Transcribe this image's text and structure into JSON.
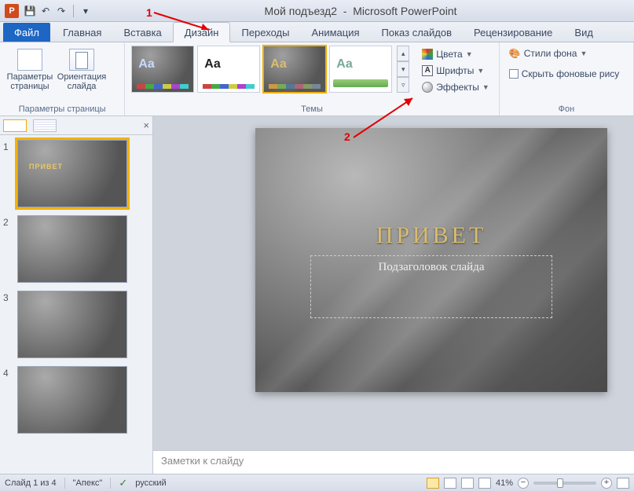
{
  "titlebar": {
    "doc": "Мой подъезд2",
    "app": "Microsoft PowerPoint"
  },
  "annotations": {
    "n1": "1",
    "n2": "2"
  },
  "tabs": {
    "file": "Файл",
    "items": [
      "Главная",
      "Вставка",
      "Дизайн",
      "Переходы",
      "Анимация",
      "Показ слайдов",
      "Рецензирование",
      "Вид"
    ],
    "activeIndex": 2
  },
  "ribbon": {
    "pageSetup": {
      "params": "Параметры страницы",
      "orient": "Ориентация слайда",
      "groupLabel": "Параметры страницы"
    },
    "themes": {
      "groupLabel": "Темы",
      "colors": "Цвета",
      "fonts": "Шрифты",
      "effects": "Эффекты"
    },
    "background": {
      "groupLabel": "Фон",
      "styles": "Стили фона",
      "hide": "Скрыть фоновые рису"
    }
  },
  "thumbnails": [
    {
      "num": "1",
      "title": "ПРИВЕТ",
      "selected": true
    },
    {
      "num": "2",
      "title": "",
      "selected": false
    },
    {
      "num": "3",
      "title": "",
      "selected": false
    },
    {
      "num": "4",
      "title": "",
      "selected": false
    }
  ],
  "slide": {
    "title": "ПРИВЕТ",
    "subtitle": "Подзаголовок слайда"
  },
  "notes": {
    "placeholder": "Заметки к слайду"
  },
  "status": {
    "slideInfo": "Слайд 1 из 4",
    "theme": "\"Апекс\"",
    "lang": "русский",
    "zoom": "41%"
  }
}
